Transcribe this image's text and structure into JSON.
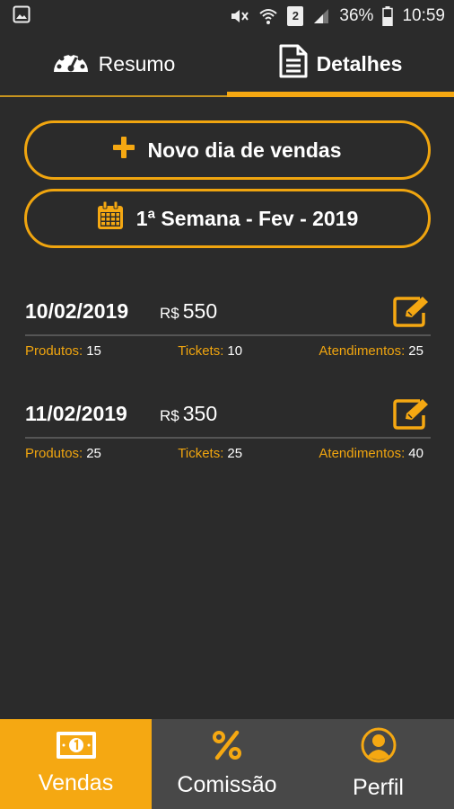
{
  "status_bar": {
    "battery_percent": "36%",
    "time": "10:59",
    "sim_slot": "2"
  },
  "tabs": [
    {
      "label": "Resumo",
      "icon": "speedometer-icon",
      "active": false
    },
    {
      "label": "Detalhes",
      "icon": "document-icon",
      "active": true
    }
  ],
  "actions": {
    "new_day_label": "Novo dia de vendas",
    "week_label": "1ª Semana - Fev - 2019"
  },
  "entries": [
    {
      "date": "10/02/2019",
      "currency": "R$",
      "amount": "550",
      "produtos_label": "Produtos:",
      "produtos": "15",
      "tickets_label": "Tickets:",
      "tickets": "10",
      "atendimentos_label": "Atendimentos:",
      "atendimentos": "25"
    },
    {
      "date": "11/02/2019",
      "currency": "R$",
      "amount": "350",
      "produtos_label": "Produtos:",
      "produtos": "25",
      "tickets_label": "Tickets:",
      "tickets": "25",
      "atendimentos_label": "Atendimentos:",
      "atendimentos": "40"
    }
  ],
  "bottom_nav": [
    {
      "label": "Vendas",
      "icon": "money-bill-icon",
      "active": true
    },
    {
      "label": "Comissão",
      "icon": "percent-icon",
      "active": false
    },
    {
      "label": "Perfil",
      "icon": "user-circle-icon",
      "active": false
    }
  ],
  "colors": {
    "accent": "#f5a812",
    "background": "#2b2b2b",
    "nav_background": "#484848"
  }
}
